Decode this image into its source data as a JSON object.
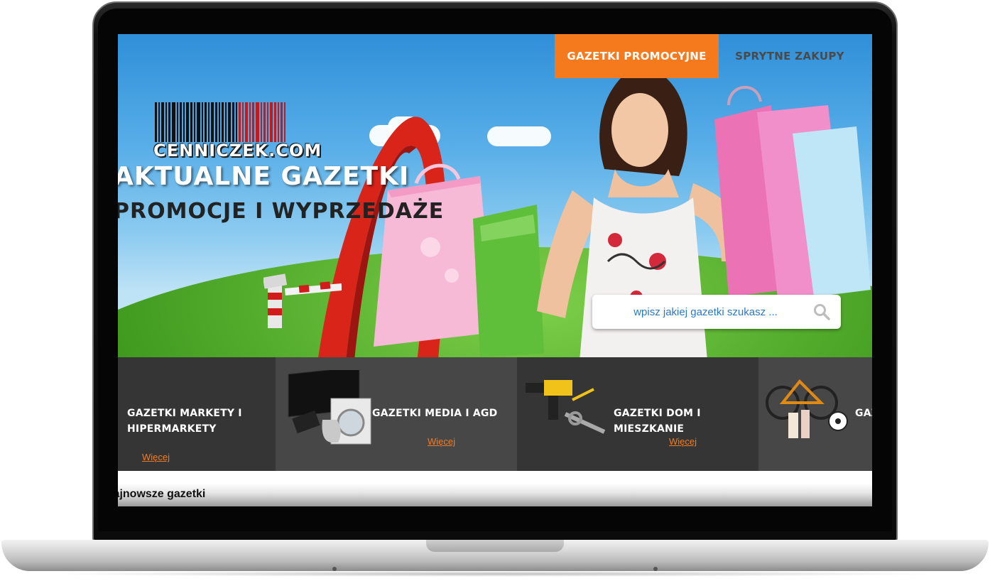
{
  "brand": {
    "logo_text": "CENNICZEK.COM"
  },
  "nav": {
    "active_tab": "GAZETKI PROMOCYJNE",
    "tab_2": "SPRYTNE ZAKUPY",
    "accent_color": "#f57a1e"
  },
  "hero": {
    "title_line1": "AKTUALNE GAZETKI",
    "title_line2": "PROMOCJE I WYPRZEDAŻE"
  },
  "search": {
    "placeholder": "wpisz jakiej gazetki szukasz ...",
    "icon": "search-icon"
  },
  "categories": [
    {
      "title_line1": "GAZETKI MARKETY I",
      "title_line2": "HIPERMARKETY",
      "more": "Więcej"
    },
    {
      "title": "GAZETKI MEDIA I AGD",
      "more": "Więcej",
      "icon": "appliances-image"
    },
    {
      "title": "GAZETKI DOM I MIESZKANIE",
      "more": "Więcej",
      "icon": "tools-image"
    },
    {
      "title": "GAZ",
      "icon": "sport-image"
    }
  ],
  "section": {
    "title": "Najnowsze gazetki"
  }
}
